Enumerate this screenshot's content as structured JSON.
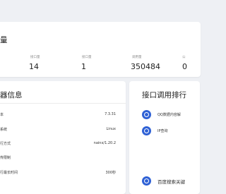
{
  "stats_panel": {
    "title": "量",
    "stats": [
      {
        "label": "接口量",
        "value": "14"
      },
      {
        "label": "接口量",
        "value": "1"
      },
      {
        "label": "调用量",
        "value": "350484"
      },
      {
        "label": "公",
        "value": "0"
      }
    ]
  },
  "server_panel": {
    "title": "器信息",
    "rows": [
      {
        "label": "本",
        "value": "7.3.31"
      },
      {
        "label": "系统",
        "value": "Linux"
      },
      {
        "label": "行方式",
        "value": "nainx/1.20.2"
      },
      {
        "label": "传限制",
        "value": ""
      },
      {
        "label": "行最长时间",
        "value": "300秒"
      }
    ]
  },
  "rank_panel": {
    "title": "接口调用排行",
    "items": [
      {
        "name": "QQ数据内容解",
        "icon": "api-icon"
      },
      {
        "name": "IP查询",
        "icon": "api-icon"
      },
      {
        "name": "",
        "icon": "api-icon"
      },
      {
        "name": "",
        "icon": "api-icon"
      },
      {
        "name": "百度搜索关键",
        "icon": "api-icon"
      }
    ]
  },
  "colors": {
    "accent": "#2f61d5",
    "background": "#eef0f4",
    "panel": "#ffffff"
  }
}
